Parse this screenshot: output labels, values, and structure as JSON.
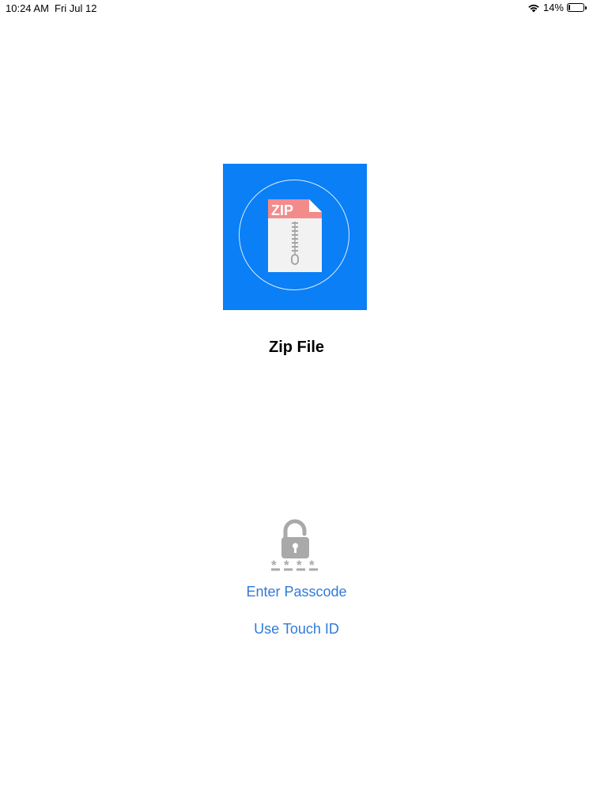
{
  "status_bar": {
    "time": "10:24 AM",
    "date": "Fri Jul 12",
    "battery_percent_label": "14%",
    "battery_level": 0.14,
    "wifi_icon": "wifi-icon",
    "battery_icon": "battery-icon"
  },
  "app": {
    "name": "Zip File",
    "icon": "zip-file-icon",
    "icon_badge_text": "ZIP",
    "icon_bg_color": "#0a7ff6",
    "badge_color": "#f08080"
  },
  "lock": {
    "icon": "padlock-icon",
    "enter_passcode_label": "Enter Passcode",
    "touch_id_label": "Use Touch ID",
    "link_color": "#2f7bd9"
  }
}
